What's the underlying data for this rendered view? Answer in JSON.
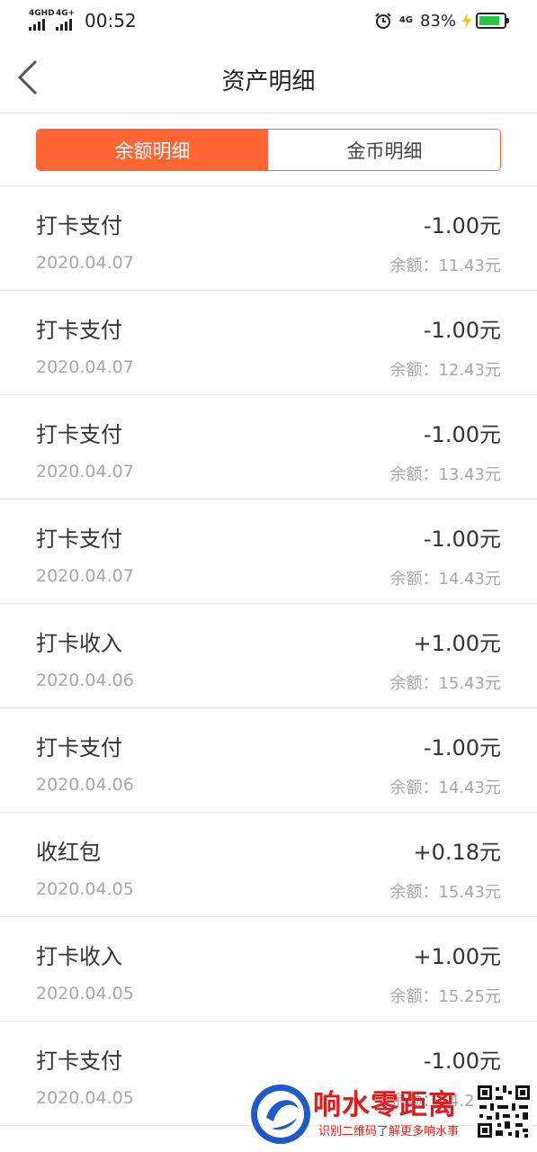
{
  "status_bar": {
    "signal1_label": "4GHD",
    "signal2_label": "4G+",
    "time": "00:52",
    "network_label": "4G",
    "battery_percent": "83%",
    "battery_level": 0.83,
    "battery_color": "#28c940",
    "icons": [
      "signal-icon",
      "alarm-icon",
      "charging-bolt-icon",
      "battery-icon"
    ]
  },
  "nav": {
    "back_icon": "chevron-left-icon",
    "title": "资产明细"
  },
  "tabs": [
    {
      "label": "余额明细",
      "active": true
    },
    {
      "label": "金币明细",
      "active": false
    }
  ],
  "accent_color": "#ff6633",
  "transactions": [
    {
      "title": "打卡支付",
      "amount": "-1.00元",
      "date": "2020.04.07",
      "balance": "余额：11.43元"
    },
    {
      "title": "打卡支付",
      "amount": "-1.00元",
      "date": "2020.04.07",
      "balance": "余额：12.43元"
    },
    {
      "title": "打卡支付",
      "amount": "-1.00元",
      "date": "2020.04.07",
      "balance": "余额：13.43元"
    },
    {
      "title": "打卡支付",
      "amount": "-1.00元",
      "date": "2020.04.07",
      "balance": "余额：14.43元"
    },
    {
      "title": "打卡收入",
      "amount": "+1.00元",
      "date": "2020.04.06",
      "balance": "余额：15.43元"
    },
    {
      "title": "打卡支付",
      "amount": "-1.00元",
      "date": "2020.04.06",
      "balance": "余额：14.43元"
    },
    {
      "title": "收红包",
      "amount": "+0.18元",
      "date": "2020.04.05",
      "balance": "余额：15.43元"
    },
    {
      "title": "打卡收入",
      "amount": "+1.00元",
      "date": "2020.04.05",
      "balance": "余额：15.25元"
    },
    {
      "title": "打卡支付",
      "amount": "-1.00元",
      "date": "2020.04.05",
      "balance": "余额：14.25元"
    }
  ],
  "watermark": {
    "name": "响水零距离",
    "slogan": "识别二维码了解更多响水事",
    "logo_color": "#1e5bc6",
    "text_color": "#d81e1e"
  }
}
